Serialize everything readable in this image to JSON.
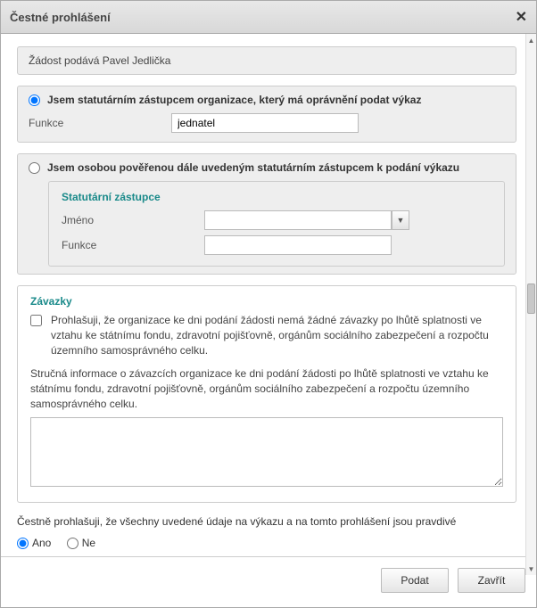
{
  "title": "Čestné prohlášení",
  "applicant_line": "Žádost podává Pavel Jedlička",
  "opt1": {
    "label": "Jsem statutárním zástupcem organizace, který má oprávnění podat výkaz",
    "funkce_label": "Funkce",
    "funkce_value": "jednatel"
  },
  "opt2": {
    "label": "Jsem osobou pověřenou dále uvedeným statutárním zástupcem k podání výkazu",
    "legend": "Statutární zástupce",
    "jmeno_label": "Jméno",
    "funkce_label": "Funkce"
  },
  "zav": {
    "legend": "Závazky",
    "checkbox_text": "Prohlašuji, že organizace ke dni podání žádosti nemá žádné závazky po lhůtě splatnosti ve vztahu ke státnímu fondu, zdravotní pojišťovně, orgánům sociálního zabezpečení a rozpočtu územního samosprávného celku.",
    "desc": "Stručná informace o závazcích organizace ke dni podání žádosti po lhůtě splatnosti ve vztahu ke státnímu fondu, zdravotní pojišťovně, orgánům sociálního zabezpečení a rozpočtu územního samosprávného celku."
  },
  "confirm_text": "Čestně prohlašuji, že všechny uvedené údaje na výkazu a na tomto prohlášení jsou pravdivé",
  "yes": "Ano",
  "no": "Ne",
  "submit": "Podat",
  "close": "Zavřít"
}
